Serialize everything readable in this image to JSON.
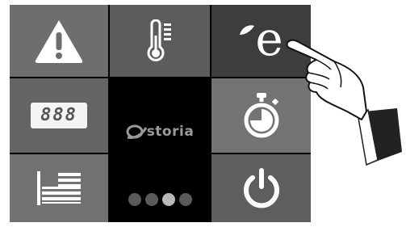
{
  "display": {
    "digits": "888"
  },
  "logo": {
    "text": "storia"
  },
  "pager": {
    "count": 4,
    "active_index": 2
  },
  "tiles": {
    "warning": {
      "icon": "warning-icon"
    },
    "temperature": {
      "icon": "thermometer-icon"
    },
    "eco": {
      "icon": "eco-leaf-e-icon",
      "letter": "e"
    },
    "display": {
      "icon": "seven-segment-display-icon"
    },
    "timer": {
      "icon": "stopwatch-icon"
    },
    "language": {
      "icon": "flag-icon"
    },
    "power": {
      "icon": "power-icon"
    }
  },
  "colors": {
    "panel_bg": "#000000",
    "icon": "#ffffff",
    "eco_tile": "#3d3d3d",
    "dot_active": "#b8b8b8",
    "dot_inactive": "#5a5a5a"
  }
}
